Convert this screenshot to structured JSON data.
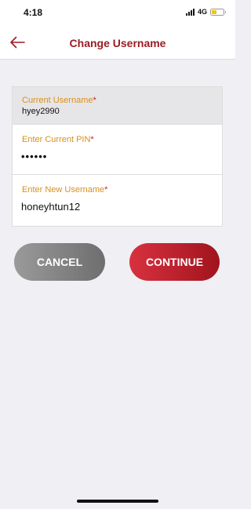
{
  "status_bar": {
    "time": "4:18",
    "network": "4G",
    "battery_level": 0.45,
    "battery_color": "#f2c50c"
  },
  "header": {
    "title": "Change Username",
    "back_icon": "arrow-left-icon"
  },
  "form": {
    "current_username": {
      "label": "Current Username",
      "required_mark": "*",
      "value": "hyey2990"
    },
    "current_pin": {
      "label": "Enter Current PIN",
      "required_mark": "*",
      "value": "••••••"
    },
    "new_username": {
      "label": "Enter New Username",
      "required_mark": "*",
      "value": "honeyhtun12"
    }
  },
  "actions": {
    "cancel_label": "CANCEL",
    "continue_label": "CONTINUE"
  },
  "colors": {
    "brand": "#9b1c22",
    "label": "#d9901a",
    "required": "#c8202a",
    "continue_start": "#d8313f",
    "continue_end": "#a0141d",
    "cancel_start": "#9a9a9a",
    "cancel_end": "#6e6e6e"
  }
}
